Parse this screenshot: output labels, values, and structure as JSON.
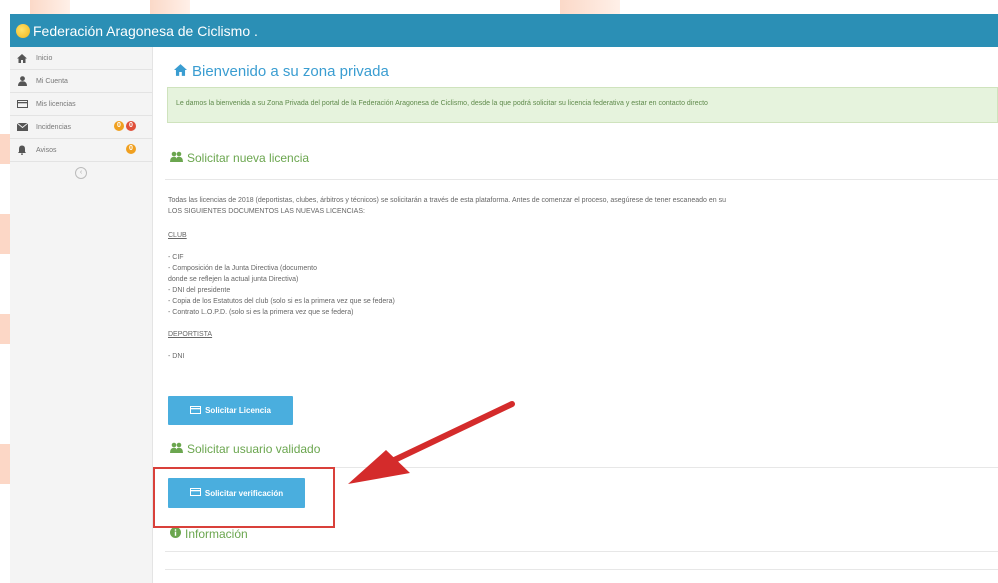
{
  "app": {
    "title": "Federación Aragonesa de Ciclismo ."
  },
  "sidebar": {
    "items": [
      {
        "label": "Inicio",
        "icon": "home-icon"
      },
      {
        "label": "Mi Cuenta",
        "icon": "user-icon"
      },
      {
        "label": "Mis licencias",
        "icon": "card-icon"
      },
      {
        "label": "Incidencias",
        "icon": "envelope-icon",
        "badges": [
          "0",
          "0"
        ]
      },
      {
        "label": "Avisos",
        "icon": "bell-icon",
        "badges": [
          "0"
        ]
      }
    ],
    "collapse_symbol": "‹"
  },
  "main": {
    "welcome_title": "Bienvenido a su zona privada",
    "welcome_text": "Le damos la bienvenida a su Zona Privada del portal de la Federación Aragonesa de Ciclismo, desde la que podrá solicitar su licencia federativa y estar en contacto directo",
    "license_section_title": "Solicitar nueva licencia",
    "license_intro_line1": "Todas las licencias de 2018 (deportistas, clubes, árbitros y técnicos) se solicitarán a través de esta plataforma. Antes de comenzar el proceso, asegúrese de tener escaneado en su",
    "license_intro_line2": "LOS SIGUIENTES DOCUMENTOS LAS NUEVAS LICENCIAS:",
    "club_heading": "CLUB",
    "club_items": [
      "- CIF",
      "- Composición de la Junta Directiva (documento",
      "donde se reflejen la actual junta Directiva)",
      "- DNI del presidente",
      "- Copia de los Estatutos del club (solo si es la primera vez que se federa)",
      "- Contrato L.O.P.D. (solo si es la primera vez que se federa)"
    ],
    "deportista_heading": "DEPORTISTA",
    "deportista_items": [
      "- DNI"
    ],
    "license_button": "Solicitar Licencia",
    "validated_section_title": "Solicitar usuario validado",
    "verification_button": "Solicitar verificación",
    "info_section_title": "Información"
  },
  "colors": {
    "topbar": "#2b8fb5",
    "accent_blue": "#3a9dd1",
    "button": "#4aaede",
    "success_text": "#6ba64f",
    "highlight_red": "#d9403a",
    "arrow_red": "#d42b2b"
  }
}
